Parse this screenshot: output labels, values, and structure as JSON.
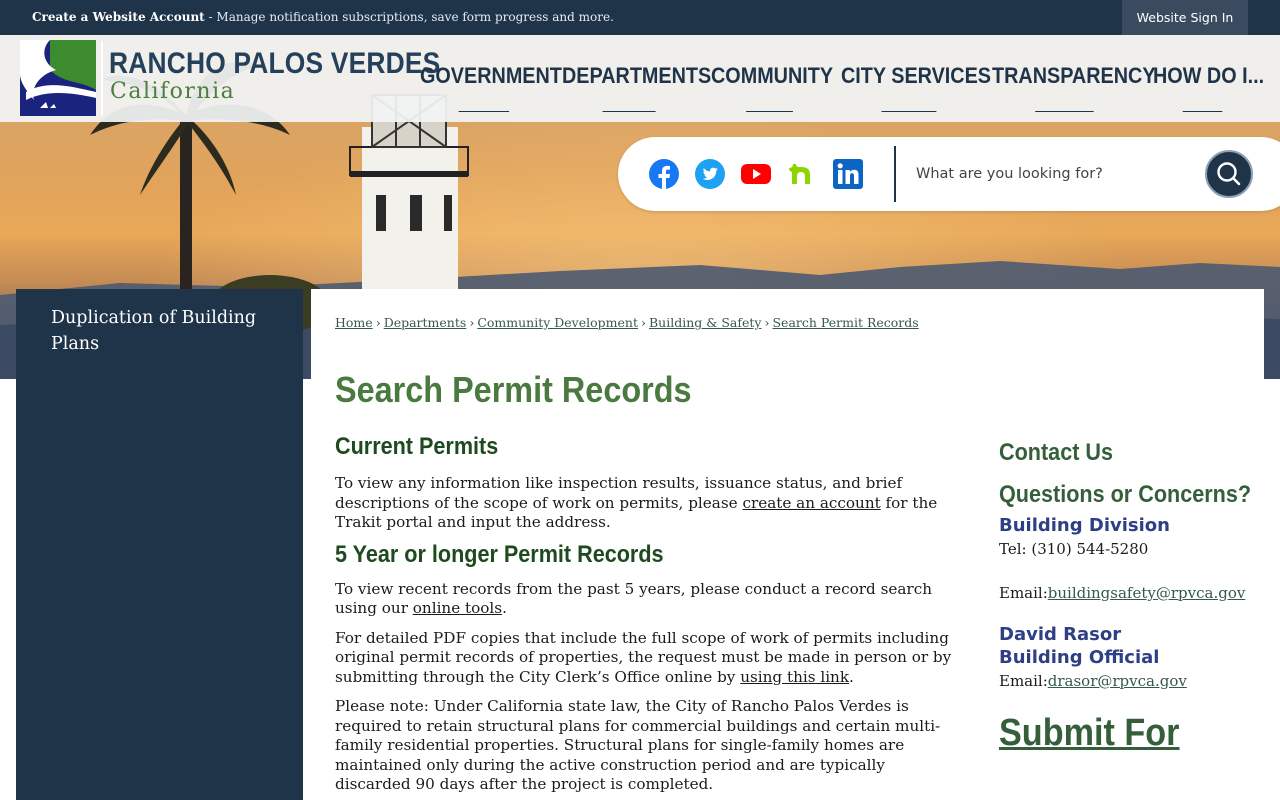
{
  "topbar": {
    "create_account": "Create a Website Account",
    "message": " - Manage notification subscriptions, save form progress and more.",
    "signin": "Website Sign In"
  },
  "header": {
    "title": "RANCHO PALOS VERDES",
    "subtitle": "California",
    "nav": [
      "GOVERNMENT",
      "DEPARTMENTS",
      "COMMUNITY",
      "CITY SERVICES",
      "TRANSPARENCY",
      "HOW DO I..."
    ]
  },
  "social": {
    "icons": [
      "facebook-icon",
      "twitter-icon",
      "youtube-icon",
      "nextdoor-icon",
      "linkedin-icon"
    ],
    "colors": {
      "facebook": "#1877f2",
      "twitter": "#1da1f2",
      "youtube": "#ff0000",
      "nextdoor": "#8ed500",
      "linkedin": "#0a66c2"
    }
  },
  "search": {
    "placeholder": "What are you looking for?"
  },
  "sidebar": {
    "item": "Duplication of Building Plans"
  },
  "breadcrumb": {
    "items": [
      "Home",
      "Departments",
      "Community Development",
      "Building & Safety",
      "Search Permit Records"
    ],
    "separator": "›"
  },
  "page": {
    "title": "Search Permit Records",
    "current_heading": "Current Permits",
    "current_p1": "To view any information like inspection results, issuance status, and brief descriptions of the scope of work on permits, please ",
    "current_link": "create an account",
    "current_p2": " for the Trakit portal and input the address.",
    "five_heading": "5 Year or longer Permit Records",
    "five_p1a": "To view recent records from the past 5 years, please conduct a record search using our ",
    "five_p1_link": "online tools",
    "five_p1b": ".",
    "five_p2a": "For detailed PDF copies that include the full scope of work of permits including original permit records of properties, the request must be made in person or by submitting through the City Clerk’s Office online by ",
    "five_p2_link": "using this link",
    "five_p2b": ".",
    "note": "Please note: Under California state law, the City of Rancho Palos Verdes is required to retain structural plans for commercial buildings and certain multi-family residential properties. Structural plans for single-family homes are maintained only during the active construction period and are typically discarded 90 days after the project is completed."
  },
  "contact": {
    "heading": "Contact Us",
    "questions": "Questions or Concerns?",
    "division": "Building Division",
    "tel": "Tel: (310) 544-5280",
    "email_label": "Email:",
    "email1": "buildingsafety@rpvca.gov",
    "person": "David Rasor",
    "role": "Building Official",
    "email2": "drasor@rpvca.gov",
    "submit": "Submit For"
  },
  "colors": {
    "navy": "#1f3349",
    "green": "#4a7a3f",
    "blue_heading": "#2e3f86"
  }
}
